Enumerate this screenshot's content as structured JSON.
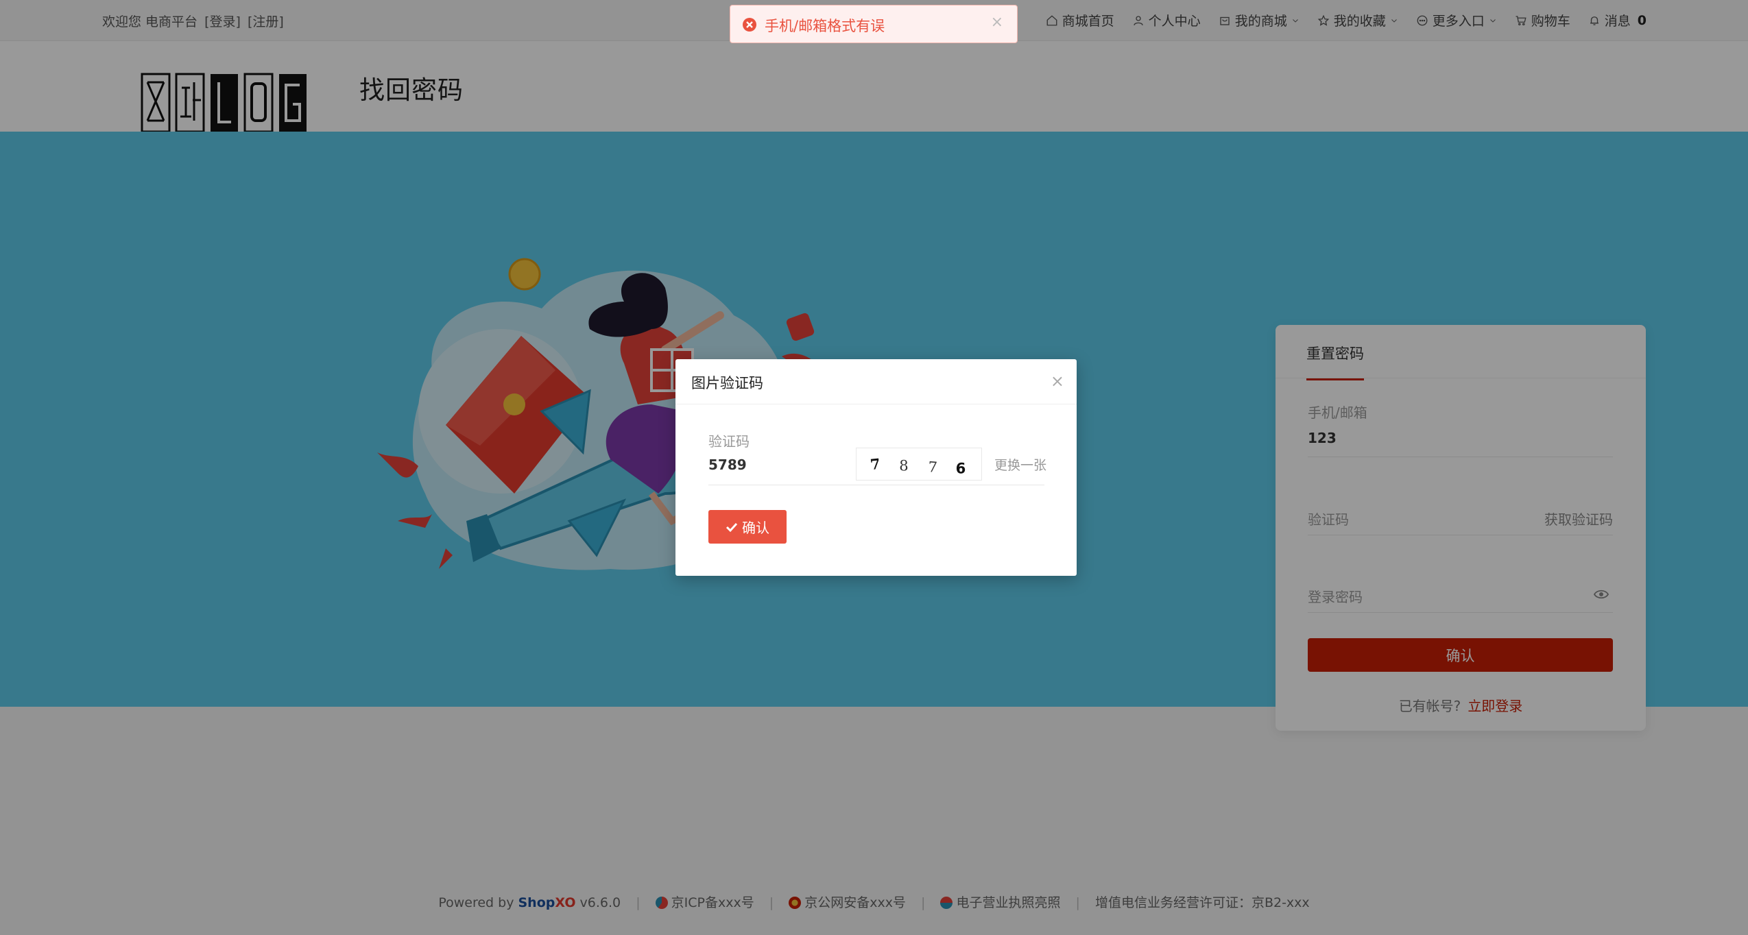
{
  "topbar": {
    "welcome": "欢迎您 电商平台",
    "login_link": "[登录]",
    "register_link": "[注册]",
    "nav": {
      "home": "商城首页",
      "personal_center": "个人中心",
      "my_mall": "我的商城",
      "favorites": "我的收藏",
      "more_entries": "更多入口",
      "cart": "购物车",
      "messages": "消息",
      "message_count": "0"
    }
  },
  "header": {
    "page_title": "找回密码"
  },
  "card": {
    "tab_label": "重置密码",
    "phone_label": "手机/邮箱",
    "phone_value": "123",
    "code_placeholder": "验证码",
    "get_code": "获取验证码",
    "password_placeholder": "登录密码",
    "submit_label": "确认",
    "have_account": "已有帐号?",
    "login_now": "立即登录"
  },
  "modal": {
    "title": "图片验证码",
    "close": "×",
    "field_label": "验证码",
    "field_value": "5789",
    "captcha_chars": [
      "7",
      "8",
      "7",
      "6"
    ],
    "refresh_label": "更换一张",
    "confirm_label": "确认"
  },
  "toast": {
    "message": "手机/邮箱格式有误",
    "close": "×"
  },
  "footer": {
    "powered_by": "Powered by",
    "brand": "ShopXO",
    "brand_shop": "Shop",
    "brand_xo": "XO",
    "version": "v6.6.0",
    "icp": "京ICP备xxx号",
    "police": "京公网安备xxx号",
    "license": "电子营业执照亮照",
    "telecom": "增值电信业务经营许可证：京B2-xxx",
    "separator": "|"
  },
  "colors": {
    "accent": "#c81f05",
    "banner": "#5ecae9",
    "toast_text": "#e9523f",
    "brand_blue": "#1b4f9c"
  }
}
